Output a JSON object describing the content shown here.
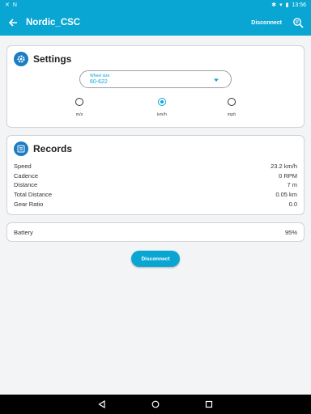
{
  "status": {
    "time": "13:56"
  },
  "app": {
    "title": "Nordic_CSC",
    "disconnect": "Disconnect"
  },
  "settings": {
    "title": "Settings",
    "wheel": {
      "label": "Wheel size",
      "value": "60-622"
    },
    "units": [
      {
        "label": "m/s",
        "selected": false
      },
      {
        "label": "km/h",
        "selected": true
      },
      {
        "label": "mph",
        "selected": false
      }
    ]
  },
  "records": {
    "title": "Records",
    "rows": [
      {
        "label": "Speed",
        "value": "23.2 km/h"
      },
      {
        "label": "Cadence",
        "value": "0 RPM"
      },
      {
        "label": "Distance",
        "value": "7 m"
      },
      {
        "label": "Total Distance",
        "value": "0.05 km"
      },
      {
        "label": "Gear Ratio",
        "value": "0.0"
      }
    ]
  },
  "battery": {
    "label": "Battery",
    "value": "95%"
  },
  "button": {
    "label": "Disconnect"
  },
  "colors": {
    "accent": "#0aa6d3",
    "icon_bg": "#1b7cc4"
  }
}
